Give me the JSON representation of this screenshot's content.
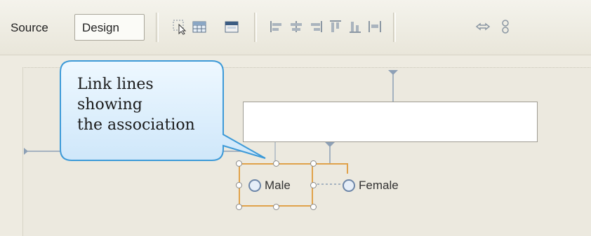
{
  "toolbar": {
    "source_label": "Source",
    "design_label": "Design",
    "tools": [
      {
        "icon": "select-element-icon"
      },
      {
        "icon": "table-icon"
      },
      {
        "icon": "form-icon"
      },
      {
        "icon": "align-left-icon"
      },
      {
        "icon": "align-center-icon"
      },
      {
        "icon": "align-right-icon"
      },
      {
        "icon": "align-top-icon"
      },
      {
        "icon": "align-middle-icon"
      },
      {
        "icon": "align-bottom-icon"
      },
      {
        "icon": "link-icon"
      },
      {
        "icon": "unlink-icon"
      }
    ]
  },
  "design": {
    "radio_options": [
      "Male",
      "Female"
    ]
  },
  "callout": {
    "lines": [
      "Link lines",
      "showing",
      "the association"
    ],
    "bubble_color": "#d6ecfb",
    "border_color": "#3d9ad8"
  },
  "colors": {
    "selection": "#e0a24a",
    "link_line": "#7c8da0"
  }
}
